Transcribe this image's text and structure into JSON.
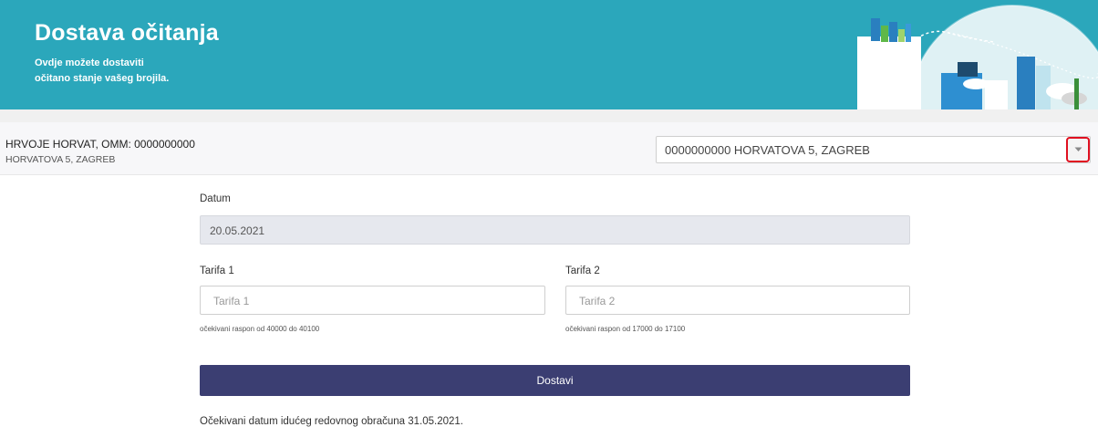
{
  "header": {
    "title": "Dostava očitanja",
    "subtitle_line1": "Ovdje možete dostaviti",
    "subtitle_line2": "očitano stanje vašeg brojila."
  },
  "customer": {
    "name": "HRVOJE HORVAT, OMM: 0000000000",
    "address": "HORVATOVA 5, ZAGREB",
    "select_value": "0000000000 HORVATOVA 5, ZAGREB"
  },
  "form": {
    "datum_label": "Datum",
    "datum_value": "20.05.2021",
    "tarifa1_label": "Tarifa 1",
    "tarifa1_placeholder": "Tarifa 1",
    "tarifa1_hint": "očekivani raspon od 40000 do 40100",
    "tarifa2_label": "Tarifa 2",
    "tarifa2_placeholder": "Tarifa 2",
    "tarifa2_hint": "očekivani raspon od 17000 do 17100",
    "submit_label": "Dostavi",
    "footnote": "Očekivani datum idućeg redovnog obračuna 31.05.2021."
  },
  "colors": {
    "banner": "#2ba7bb",
    "submit": "#3b3e72",
    "highlight": "#e01020"
  },
  "icons": {
    "dropdown": "chevron-down-icon",
    "banner_art": "city-illustration-icon"
  }
}
